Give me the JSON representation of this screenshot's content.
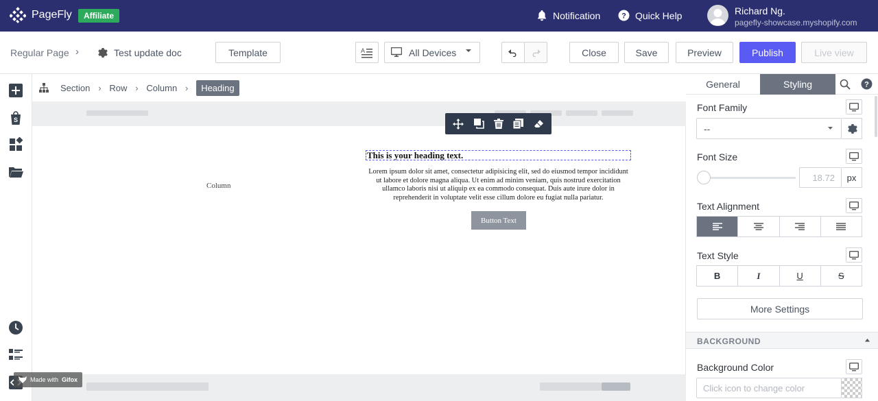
{
  "topbar": {
    "brand": "PageFly",
    "badge": "Affiliate",
    "notification": "Notification",
    "quick_help": "Quick Help",
    "user_name": "Richard Ng.",
    "user_shop": "pagefly-showcase.myshopify.com"
  },
  "actionbar": {
    "page_type": "Regular Page",
    "page_name": "Test update doc",
    "template": "Template",
    "device": "All Devices",
    "close": "Close",
    "save": "Save",
    "preview": "Preview",
    "publish": "Publish",
    "live_view": "Live view"
  },
  "breadcrumb": [
    "Section",
    "Row",
    "Column",
    "Heading"
  ],
  "canvas": {
    "column_label": "Column",
    "heading": "This is your heading text.",
    "paragraph": "Lorem ipsum dolor sit amet, consectetur adipisicing elit, sed do eiusmod tempor incididunt ut labore et dolore magna aliqua. Ut enim ad minim veniam, quis nostrud exercitation ullamco laboris nisi ut aliquip ex ea commodo consequat. Duis aute irure dolor in reprehenderit in voluptate velit esse cillum dolore eu fugiat nulla pariatur.",
    "button": "Button Text",
    "watermark_prefix": "Made with",
    "watermark_brand": "Gifox"
  },
  "panel": {
    "tabs": [
      "General",
      "Styling"
    ],
    "active_tab": "Styling",
    "font_family_label": "Font Family",
    "font_family_value": "--",
    "font_size_label": "Font Size",
    "font_size_value": "18.72",
    "font_size_unit": "px",
    "text_alignment_label": "Text Alignment",
    "text_style_label": "Text Style",
    "text_style_buttons": [
      "B",
      "I",
      "U",
      "S"
    ],
    "more_settings": "More Settings",
    "background_section": "BACKGROUND",
    "background_color_label": "Background Color",
    "background_color_placeholder": "Click icon to change color"
  },
  "colors": {
    "topbar": "#2b2f6f",
    "accent": "#5a5bf3",
    "affiliate": "#2eaa5c"
  }
}
